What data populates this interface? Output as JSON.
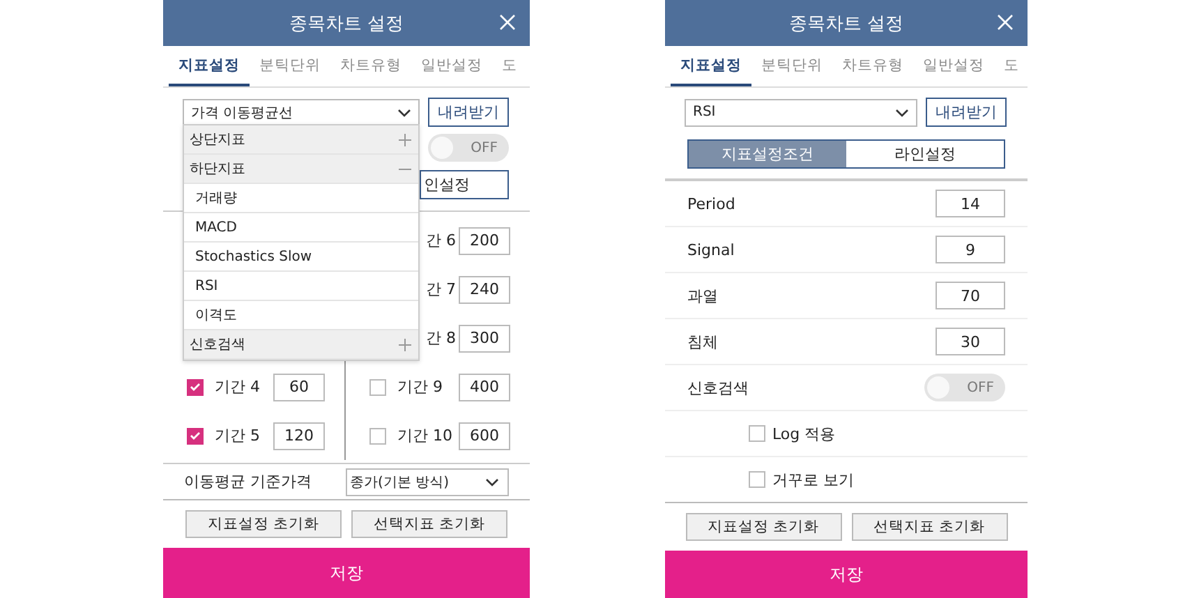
{
  "left_screen": {
    "title": "종목차트 설정",
    "tabs": [
      {
        "label": "지표설정",
        "selected": true
      },
      {
        "label": "분틱단위",
        "selected": false
      },
      {
        "label": "차트유형",
        "selected": false
      },
      {
        "label": "일반설정",
        "selected": false
      },
      {
        "label": "도",
        "selected": false
      }
    ],
    "indicator_select": {
      "value": "가격 이동평균선"
    },
    "download_button": "내려받기",
    "signal_toggle": {
      "label": "OFF",
      "on": false
    },
    "line_settings_button": "인설정",
    "periods_left": [
      {
        "label": "기간 4",
        "value": "60",
        "checked": true
      },
      {
        "label": "기간 5",
        "value": "120",
        "checked": true
      }
    ],
    "periods_right": [
      {
        "label": "간 6",
        "value": "200"
      },
      {
        "label": "간 7",
        "value": "240"
      },
      {
        "label": "간 8",
        "value": "300"
      },
      {
        "label": "기간 9",
        "value": "400",
        "checked": false
      },
      {
        "label": "기간 10",
        "value": "600",
        "checked": false
      }
    ],
    "base_price": {
      "label": "이동평균 기준가격",
      "value": "종가(기본 방식)"
    },
    "dropdown": [
      {
        "label": "상단지표",
        "kind": "group",
        "expanded": false
      },
      {
        "label": "하단지표",
        "kind": "group",
        "expanded": true
      },
      {
        "label": "거래량",
        "kind": "item"
      },
      {
        "label": "MACD",
        "kind": "item"
      },
      {
        "label": "Stochastics Slow",
        "kind": "item"
      },
      {
        "label": "RSI",
        "kind": "item"
      },
      {
        "label": "이격도",
        "kind": "item"
      },
      {
        "label": "신호검색",
        "kind": "group",
        "expanded": false
      }
    ],
    "footer_buttons": [
      "지표설정 초기화",
      "선택지표 초기화"
    ],
    "save_button": "저장"
  },
  "right_screen": {
    "title": "종목차트 설정",
    "tabs": [
      {
        "label": "지표설정",
        "selected": true
      },
      {
        "label": "분틱단위",
        "selected": false
      },
      {
        "label": "차트유형",
        "selected": false
      },
      {
        "label": "일반설정",
        "selected": false
      },
      {
        "label": "도",
        "selected": false
      }
    ],
    "indicator_select": {
      "value": "RSI"
    },
    "download_button": "내려받기",
    "segments": [
      {
        "label": "지표설정조건",
        "selected": true
      },
      {
        "label": "라인설정",
        "selected": false
      }
    ],
    "settings": [
      {
        "label": "Period",
        "kind": "input",
        "value": "14"
      },
      {
        "label": "Signal",
        "kind": "input",
        "value": "9"
      },
      {
        "label": "과열",
        "kind": "input",
        "value": "70"
      },
      {
        "label": "침체",
        "kind": "input",
        "value": "30"
      },
      {
        "label": "신호검색",
        "kind": "toggle",
        "on": false,
        "toggle_label": "OFF"
      },
      {
        "label": "Log 적용",
        "kind": "checkbox",
        "checked": false
      },
      {
        "label": "거꾸로 보기",
        "kind": "checkbox",
        "checked": false
      }
    ],
    "footer_buttons": [
      "지표설정 초기화",
      "선택지표 초기화"
    ],
    "save_button": "저장"
  }
}
